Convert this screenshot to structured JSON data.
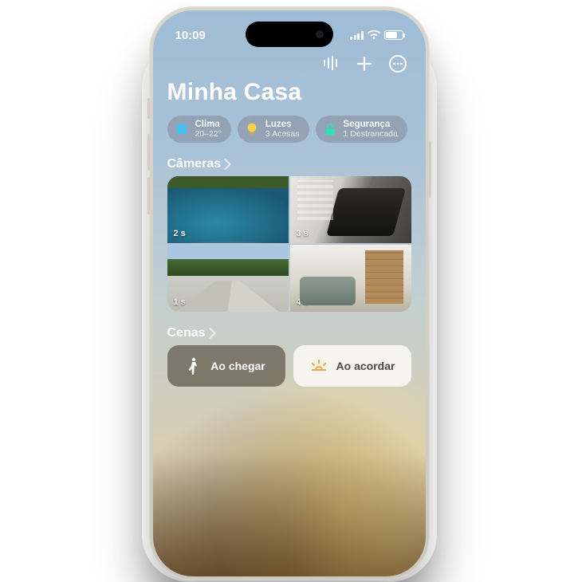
{
  "status": {
    "time": "10:09"
  },
  "toolbar": {
    "intercom_icon": "intercom",
    "add_icon": "plus",
    "more_icon": "ellipsis"
  },
  "home": {
    "title": "Minha Casa"
  },
  "pills": [
    {
      "icon": "climate",
      "color": "#33c6ff",
      "title": "Clima",
      "subtitle": "20–22°"
    },
    {
      "icon": "light",
      "color": "#ffd24a",
      "title": "Luzes",
      "subtitle": "3 Acesas"
    },
    {
      "icon": "lock",
      "color": "#2fe0b5",
      "title": "Segurança",
      "subtitle": "1 Destrancada"
    }
  ],
  "cameras": {
    "heading": "Câmeras",
    "items": [
      {
        "ts": "2 s"
      },
      {
        "ts": "3 s"
      },
      {
        "ts": "1 s"
      },
      {
        "ts": "4 s"
      }
    ]
  },
  "scenes": {
    "heading": "Cenas",
    "items": [
      {
        "label": "Ao chegar",
        "variant": "dark",
        "icon": "arrive"
      },
      {
        "label": "Ao acordar",
        "variant": "light",
        "icon": "sunrise"
      }
    ]
  }
}
